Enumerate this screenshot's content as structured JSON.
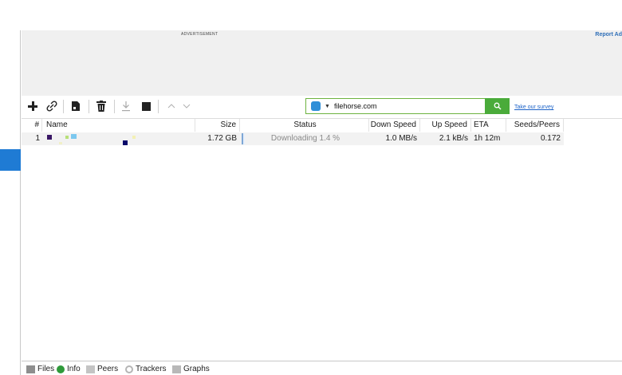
{
  "ad": {
    "label": "ADVERTISEMENT",
    "report": "Report Ad"
  },
  "toolbar": {
    "add": "add-torrent-icon",
    "link": "add-link-icon",
    "create": "create-torrent-icon",
    "remove": "trash-icon",
    "download": "download-icon",
    "stop": "stop-icon",
    "up": "up-icon",
    "down": "down-icon"
  },
  "search": {
    "value": "filehorse.com",
    "go": "search-icon"
  },
  "survey": "Take our survey",
  "table": {
    "headers": [
      "#",
      "Name",
      "Size",
      "Status",
      "Down Speed",
      "Up Speed",
      "ETA",
      "Seeds/Peers"
    ],
    "rows": [
      {
        "num": "1",
        "name": "",
        "size": "1.72 GB",
        "status": "Downloading 1.4 %",
        "progress": 0.014,
        "down": "1.0 MB/s",
        "up": "2.1 kB/s",
        "eta": "1h 12m",
        "seeds": "0.172"
      }
    ]
  },
  "tabs": [
    "Files",
    "Info",
    "Peers",
    "Trackers",
    "Graphs"
  ],
  "colors": {
    "accent": "#1f7bd4",
    "search_border": "#6db33f",
    "search_button": "#4aab3a",
    "link": "#1d63c8"
  }
}
